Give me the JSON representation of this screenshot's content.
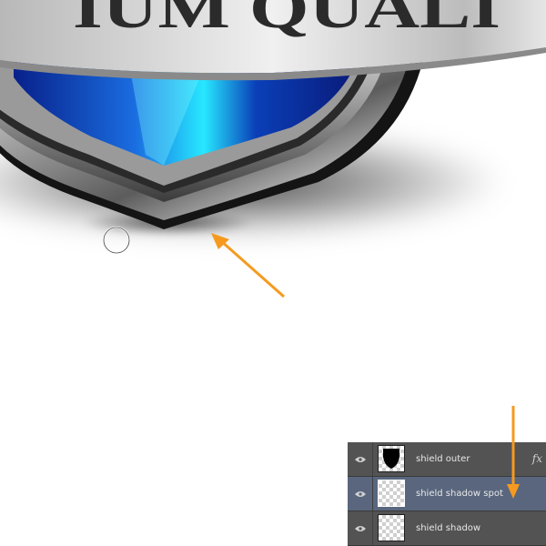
{
  "canvas": {
    "banner_text": "IUM QUALI",
    "arrow_color": "#f59a1f",
    "brush_cursor": "circle-brush-cursor"
  },
  "layers_panel": {
    "layers": [
      {
        "name": "shield outer",
        "visible": true,
        "has_effects": true,
        "fx_label": "fx",
        "selected": false,
        "thumbnail": "black-shield-mask"
      },
      {
        "name": "shield shadow spot",
        "visible": true,
        "has_effects": false,
        "selected": true,
        "thumbnail": "transparent"
      },
      {
        "name": "shield shadow",
        "visible": true,
        "has_effects": false,
        "selected": false,
        "thumbnail": "transparent"
      }
    ],
    "selected_color": "#59667e",
    "panel_color": "#535353"
  }
}
